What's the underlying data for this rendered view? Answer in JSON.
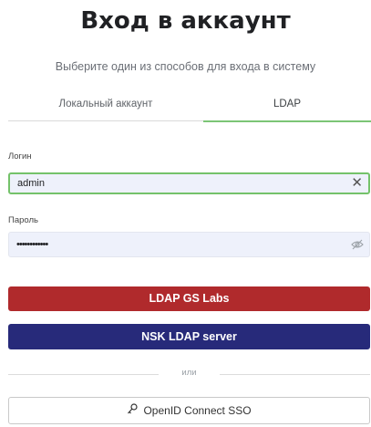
{
  "title": "Вход в аккаунт",
  "subtitle": "Выберите один из способов для входа в систему",
  "tabs": {
    "local": "Локальный аккаунт",
    "ldap": "LDAP",
    "active": "ldap"
  },
  "login": {
    "label": "Логин",
    "value": "admin"
  },
  "password": {
    "label": "Пароль",
    "value": "••••••••••••"
  },
  "buttons": {
    "ldap_gs": "LDAP GS Labs",
    "nsk_ldap": "NSK LDAP server",
    "sso": "OpenID Connect SSO"
  },
  "divider_text": "или",
  "colors": {
    "accent_green": "#74c26a",
    "button_red": "#b02a2c",
    "button_navy": "#272a7a",
    "field_bg": "#eef1fb"
  },
  "icons": {
    "clear": "close-icon",
    "password_toggle": "eye-off-icon",
    "sso": "key-icon"
  }
}
